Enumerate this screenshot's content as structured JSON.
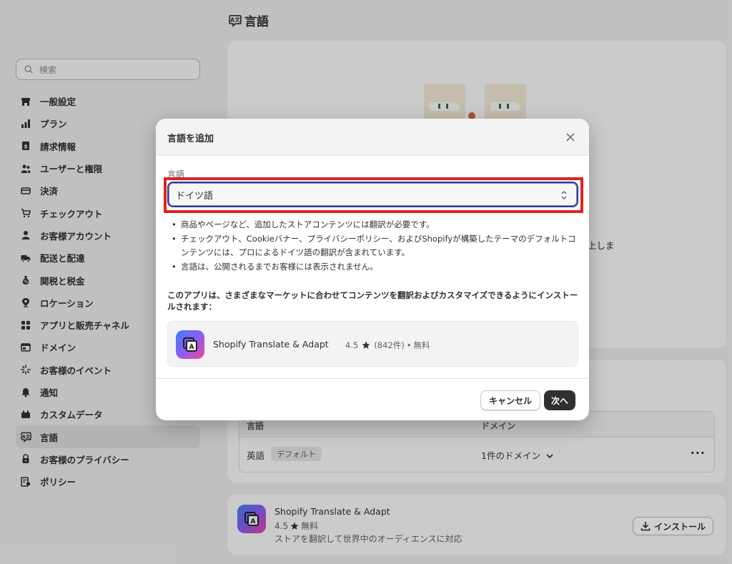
{
  "sidebar": {
    "search_placeholder": "検索",
    "items": [
      {
        "label": "一般設定",
        "icon": "store-icon"
      },
      {
        "label": "プラン",
        "icon": "plan-chart-icon"
      },
      {
        "label": "請求情報",
        "icon": "billing-icon"
      },
      {
        "label": "ユーザーと権限",
        "icon": "users-icon"
      },
      {
        "label": "決済",
        "icon": "payments-icon"
      },
      {
        "label": "チェックアウト",
        "icon": "cart-icon"
      },
      {
        "label": "お客様アカウント",
        "icon": "person-icon"
      },
      {
        "label": "配送と配達",
        "icon": "truck-icon"
      },
      {
        "label": "関税と税金",
        "icon": "tax-icon"
      },
      {
        "label": "ロケーション",
        "icon": "location-pin-icon"
      },
      {
        "label": "アプリと販売チャネル",
        "icon": "apps-icon"
      },
      {
        "label": "ドメイン",
        "icon": "globe-icon"
      },
      {
        "label": "お客様のイベント",
        "icon": "sparkle-icon"
      },
      {
        "label": "通知",
        "icon": "bell-icon"
      },
      {
        "label": "カスタムデータ",
        "icon": "database-icon"
      },
      {
        "label": "言語",
        "icon": "language-icon",
        "active": true
      },
      {
        "label": "お客様のプライバシー",
        "icon": "lock-icon"
      },
      {
        "label": "ポリシー",
        "icon": "policy-icon"
      }
    ]
  },
  "main": {
    "title": "言語",
    "truncated_text": "上しま",
    "languages_table": {
      "col_language": "言語",
      "col_domain": "ドメイン",
      "row_language": "英語",
      "row_badge": "デフォルト",
      "row_domain": "1件のドメイン",
      "more": "···"
    },
    "app_card": {
      "name": "Shopify Translate & Adapt",
      "rating": "4.5",
      "price": "無料",
      "description": "ストアを翻訳して世界中のオーディエンスに対応",
      "install_label": "インストール"
    }
  },
  "modal": {
    "title": "言語を追加",
    "field_label": "言語",
    "selected_language": "ドイツ語",
    "bullets": [
      "商品やページなど、追加したストアコンテンツには翻訳が必要です。",
      "チェックアウト、Cookieバナー、プライバシーポリシー、およびShopifyが構築したテーマのデフォルトコンテンツには、プロによるドイツ語の翻訳が含まれています。",
      "言語は、公開されるまでお客様には表示されません。"
    ],
    "install_note": "このアプリは、さまざまなマーケットに合わせてコンテンツを翻訳およびカスタマイズできるようにインストールされます：",
    "app": {
      "name": "Shopify Translate & Adapt",
      "rating": "4.5",
      "reviews": "(842件)",
      "separator": "•",
      "price": "無料"
    },
    "cancel_label": "キャンセル",
    "next_label": "次へ"
  },
  "colors": {
    "highlight_border": "#e1231d",
    "focus_ring": "#2f3e93",
    "primary_button": "#303030"
  }
}
